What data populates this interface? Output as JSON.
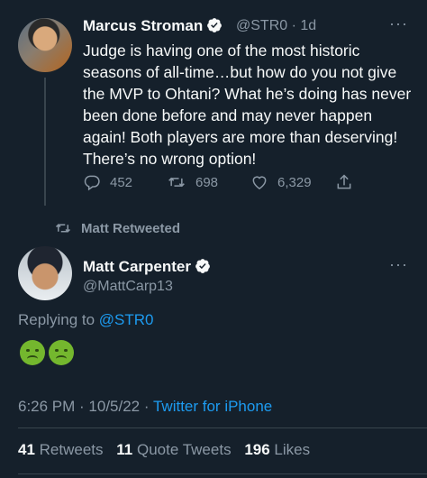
{
  "tweet1": {
    "author_name": "Marcus Stroman",
    "handle": "@STR0",
    "time": "1d",
    "text": "Judge is having one of the most historic seasons of all-time…but how do you not give the MVP to Ohtani? What he’s doing has never been done before and may never happen again! Both players are more than deserving! There’s no wrong option!",
    "replies": "452",
    "retweets": "698",
    "likes": "6,329"
  },
  "retweet_header": "Matt Retweeted",
  "tweet2": {
    "author_name": "Matt Carpenter",
    "handle": "@MattCarp13",
    "replying_prefix": "Replying to",
    "replying_to": "@STR0",
    "emoji": [
      "nauseated-face-emoji",
      "nauseated-face-emoji"
    ],
    "time": "6:26 PM",
    "date": "10/5/22",
    "source": "Twitter for iPhone",
    "stats": {
      "retweets_count": "41",
      "retweets_label": "Retweets",
      "quotes_count": "11",
      "quotes_label": "Quote Tweets",
      "likes_count": "196",
      "likes_label": "Likes"
    }
  },
  "colors": {
    "background": "#15202b",
    "text": "#f7f9f9",
    "muted": "#8b98a5",
    "accent": "#1d9bf0"
  }
}
